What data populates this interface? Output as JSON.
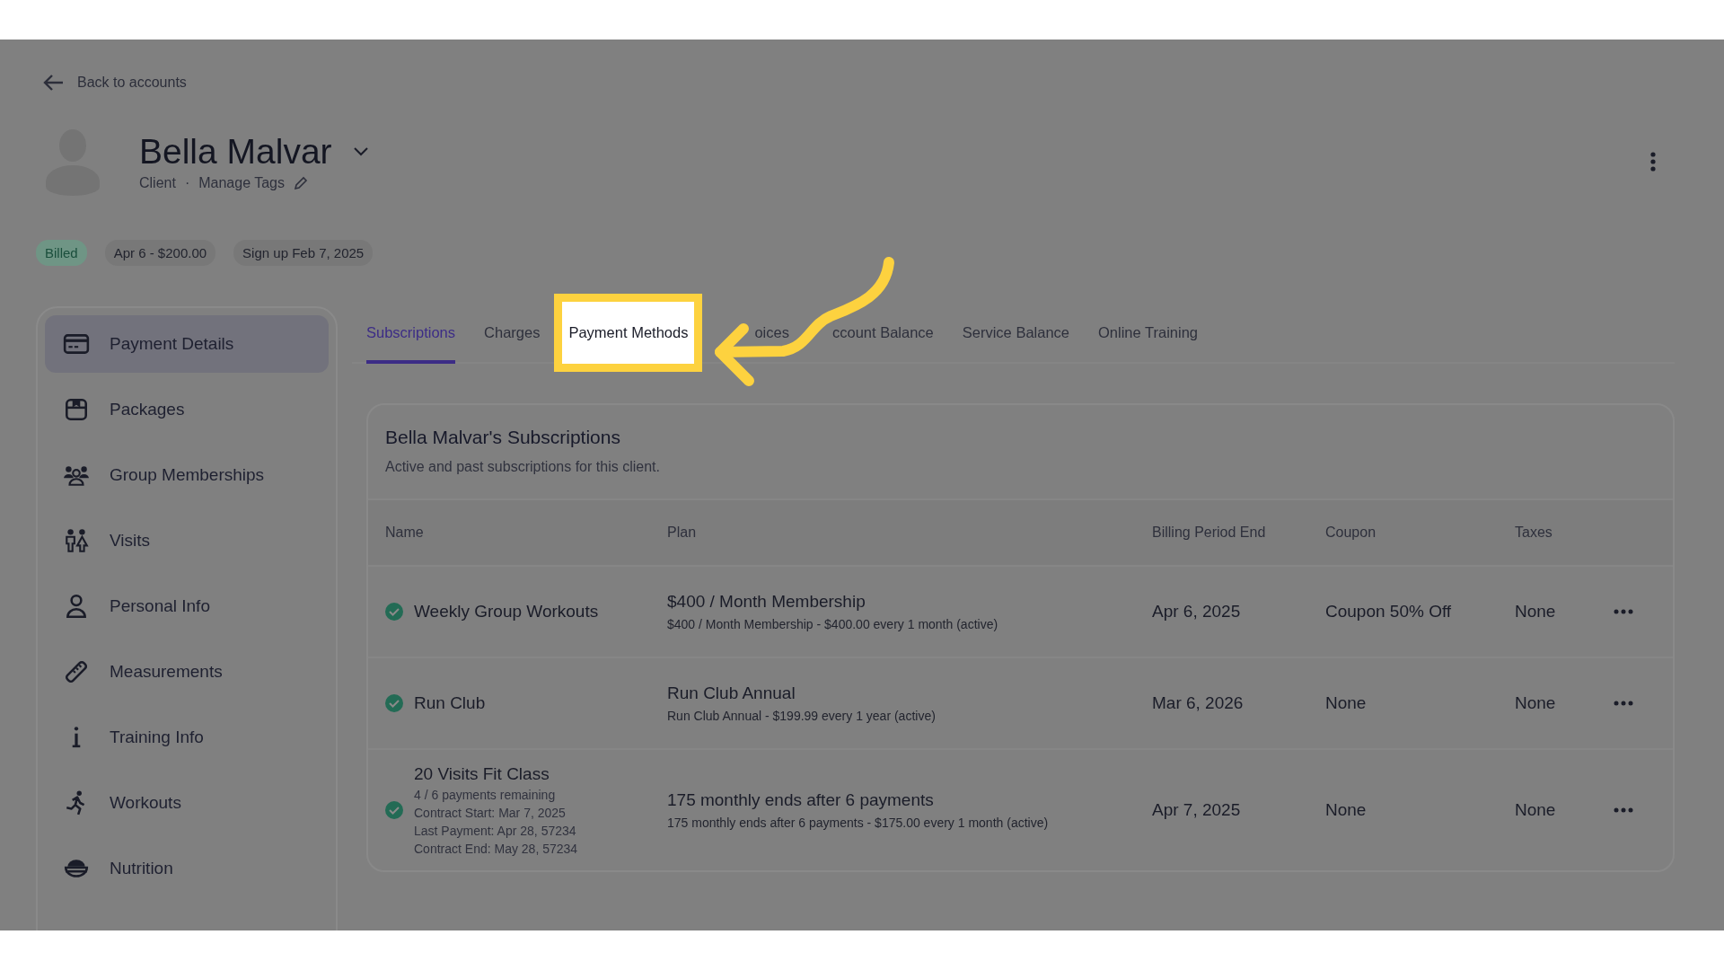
{
  "back_link": "Back to accounts",
  "client": {
    "name": "Bella Malvar",
    "role": "Client",
    "separator": "·",
    "tags_link": "Manage Tags"
  },
  "chips": [
    {
      "label": "Billed",
      "kind": "status"
    },
    {
      "label": "Apr 6 - $200.00",
      "kind": "info"
    },
    {
      "label": "Sign up Feb 7, 2025",
      "kind": "info"
    }
  ],
  "sidebar": {
    "items": [
      {
        "label": "Payment Details",
        "selected": true
      },
      {
        "label": "Packages",
        "selected": false
      },
      {
        "label": "Group Memberships",
        "selected": false
      },
      {
        "label": "Visits",
        "selected": false
      },
      {
        "label": "Personal Info",
        "selected": false
      },
      {
        "label": "Measurements",
        "selected": false
      },
      {
        "label": "Training Info",
        "selected": false
      },
      {
        "label": "Workouts",
        "selected": false
      },
      {
        "label": "Nutrition",
        "selected": false
      }
    ]
  },
  "tabs": [
    {
      "label": "Subscriptions",
      "selected": true,
      "highlighted": false
    },
    {
      "label": "Charges",
      "selected": false,
      "highlighted": false
    },
    {
      "label": "Payment Methods",
      "selected": false,
      "highlighted": true
    },
    {
      "label": "oices",
      "selected": false,
      "highlighted": false
    },
    {
      "label": "ccount Balance",
      "selected": false,
      "highlighted": false
    },
    {
      "label": "Service Balance",
      "selected": false,
      "highlighted": false
    },
    {
      "label": "Online Training",
      "selected": false,
      "highlighted": false
    }
  ],
  "card": {
    "title": "Bella Malvar's Subscriptions",
    "subtitle": "Active and past subscriptions for this client.",
    "table": {
      "columns": [
        "Name",
        "Plan",
        "Billing Period End",
        "Coupon",
        "Taxes"
      ],
      "rows": [
        {
          "name": "Weekly Group Workouts",
          "details": [],
          "plan": "$400 / Month Membership",
          "plan_detail": "$400 / Month Membership - $400.00 every 1 month (active)",
          "billing_end": "Apr 6, 2025",
          "coupon": "Coupon 50% Off",
          "taxes": "None",
          "active": true
        },
        {
          "name": "Run Club",
          "details": [],
          "plan": "Run Club Annual",
          "plan_detail": "Run Club Annual - $199.99 every 1 year (active)",
          "billing_end": "Mar 6, 2026",
          "coupon": "None",
          "taxes": "None",
          "active": true
        },
        {
          "name": "20 Visits Fit Class",
          "details": [
            "4 / 6 payments remaining",
            "Contract Start: Mar 7, 2025",
            "Last Payment: Apr 28, 57234",
            "Contract End: May 28, 57234"
          ],
          "plan": "175 monthly ends after 6 payments",
          "plan_detail": "175 monthly ends after 6 payments - $175.00 every 1 month (active)",
          "billing_end": "Apr 7, 2025",
          "coupon": "None",
          "taxes": "None",
          "active": true
        }
      ]
    }
  }
}
